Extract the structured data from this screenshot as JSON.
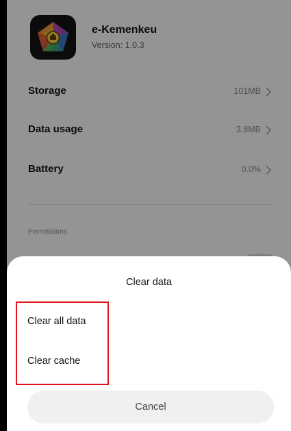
{
  "app": {
    "name": "e-Kemenkeu",
    "version": "Version: 1.0.3",
    "icon": "e-kemenkeu-app-icon"
  },
  "rows": [
    {
      "label": "Storage",
      "value": "101MB"
    },
    {
      "label": "Data usage",
      "value": "3.8MB"
    },
    {
      "label": "Battery",
      "value": "0.0%"
    }
  ],
  "permissions": {
    "title": "Permissions"
  },
  "dialog": {
    "title": "Clear data",
    "options": [
      "Clear all data",
      "Clear cache"
    ],
    "cancel": "Cancel",
    "highlight_color": "#e0141c"
  },
  "colors": {
    "scrim": "rgba(0,0,0,0.42)",
    "sheet": "#ffffff",
    "cancel_bg": "#f0f0f0"
  }
}
